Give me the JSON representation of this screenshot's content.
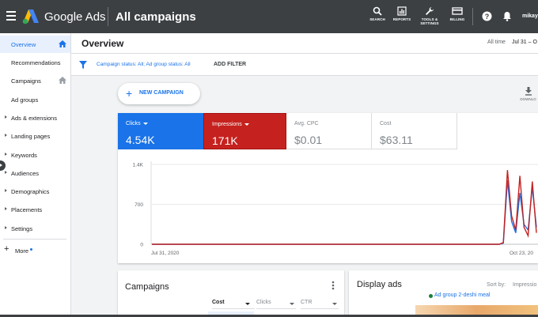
{
  "topbar": {
    "brand": "Google Ads",
    "page_title": "All campaigns",
    "tools": [
      {
        "label": "SEARCH",
        "icon": "search-icon"
      },
      {
        "label": "REPORTS",
        "icon": "reports-icon"
      },
      {
        "label": "TOOLS & SETTINGS",
        "icon": "wrench-icon"
      },
      {
        "label": "BILLING",
        "icon": "billing-card-icon"
      }
    ],
    "account": "mikayl"
  },
  "sidebar": {
    "items": [
      {
        "label": "Overview",
        "active": true
      },
      {
        "label": "Recommendations"
      },
      {
        "label": "Campaigns"
      },
      {
        "label": "Ad groups"
      },
      {
        "label": "Ads & extensions"
      },
      {
        "label": "Landing pages"
      },
      {
        "label": "Keywords"
      },
      {
        "label": "Audiences"
      },
      {
        "label": "Demographics"
      },
      {
        "label": "Placements"
      },
      {
        "label": "Settings"
      }
    ],
    "more": "More"
  },
  "overview": {
    "title": "Overview",
    "range_label": "All time",
    "range_value": "Jul 31 – O"
  },
  "filters": {
    "text": "Campaign status: All; Ad group status: All",
    "add_filter": "ADD FILTER"
  },
  "actions": {
    "new_campaign": "NEW CAMPAIGN",
    "download": "DOWNLO"
  },
  "metrics": [
    {
      "label": "Clicks",
      "value": "4.54K"
    },
    {
      "label": "Impressions",
      "value": "171K"
    },
    {
      "label": "Avg. CPC",
      "value": "$0.01"
    },
    {
      "label": "Cost",
      "value": "$63.11"
    }
  ],
  "colors": {
    "clicks": "#1a73e8",
    "impressions": "#c5221f",
    "topbar": "#3c4043"
  },
  "chart_data": {
    "type": "line",
    "x_tick_labels": [
      "Jul 31, 2020",
      "Oct 23, 20"
    ],
    "y_tick_labels": [
      "1.4K",
      "700",
      "0"
    ],
    "ylim": [
      0,
      1400
    ],
    "grid": true,
    "series": [
      {
        "name": "Clicks",
        "color": "#1a73e8",
        "values": [
          0,
          0,
          0,
          0,
          0,
          0,
          0,
          0,
          0,
          0,
          0,
          0,
          0,
          0,
          0,
          0,
          0,
          0,
          0,
          0,
          0,
          0,
          0,
          0,
          0,
          0,
          0,
          0,
          0,
          0,
          0,
          0,
          0,
          0,
          0,
          0,
          0,
          0,
          0,
          0,
          0,
          0,
          0,
          0,
          0,
          0,
          0,
          0,
          0,
          0,
          0,
          0,
          0,
          0,
          0,
          0,
          0,
          0,
          0,
          0,
          0,
          0,
          0,
          0,
          0,
          0,
          0,
          0,
          0,
          0,
          0,
          0,
          0,
          0,
          0,
          0,
          0,
          0,
          0,
          0,
          0,
          0,
          0,
          0,
          0,
          20,
          1120,
          400,
          200,
          900,
          350,
          250,
          1000,
          300
        ]
      },
      {
        "name": "Impressions",
        "color": "#c5221f",
        "values": [
          0,
          0,
          0,
          0,
          0,
          0,
          0,
          0,
          0,
          0,
          0,
          0,
          0,
          0,
          0,
          0,
          0,
          0,
          0,
          0,
          0,
          0,
          0,
          0,
          0,
          0,
          0,
          0,
          0,
          0,
          0,
          0,
          0,
          0,
          0,
          0,
          0,
          0,
          0,
          0,
          0,
          0,
          0,
          0,
          0,
          0,
          0,
          0,
          0,
          0,
          0,
          0,
          0,
          0,
          0,
          0,
          0,
          0,
          0,
          0,
          0,
          0,
          0,
          0,
          0,
          0,
          0,
          0,
          0,
          0,
          0,
          0,
          0,
          0,
          0,
          0,
          0,
          0,
          0,
          0,
          0,
          0,
          0,
          0,
          0,
          30,
          1300,
          500,
          250,
          1200,
          300,
          150,
          1100,
          200
        ]
      }
    ]
  },
  "campaigns_card": {
    "title": "Campaigns",
    "columns": [
      "Cost",
      "Clicks",
      "CTR"
    ]
  },
  "display_card": {
    "title": "Display ads",
    "sort_label": "Sort by:",
    "sort_value": "Impressio",
    "ad_group": "Ad group 2-deshi meal"
  }
}
